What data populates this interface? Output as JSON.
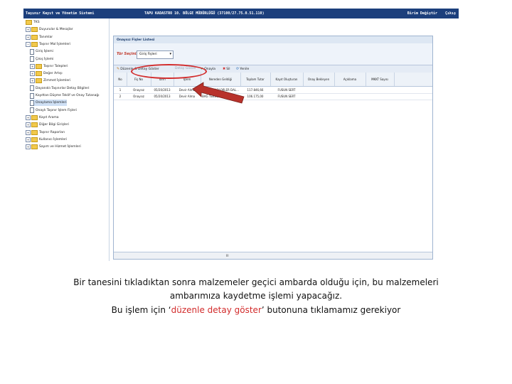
{
  "topbar": {
    "app_title": "Taşınır Kayıt ve Yönetim Sistemi",
    "office_title": "TAPU KADASTRO 10. BÖLGE MÜDÜRLÜĞÜ (37100/27.75.0.51.110)",
    "change_unit": "Birim Değiştir",
    "logout": "Çıkış"
  },
  "tree": [
    {
      "label": "TKS",
      "level": 0,
      "type": "root",
      "exp": ""
    },
    {
      "label": "Duyurular & Mesajlar",
      "level": 0,
      "type": "folder",
      "exp": "+"
    },
    {
      "label": "Tanımlar",
      "level": 0,
      "type": "folder",
      "exp": "+"
    },
    {
      "label": "Taşınır Mal İşlemleri",
      "level": 0,
      "type": "folder",
      "exp": "−"
    },
    {
      "label": "Giriş İşlemi",
      "level": 1,
      "type": "doc",
      "exp": ""
    },
    {
      "label": "Çıkış İşlemi",
      "level": 1,
      "type": "doc",
      "exp": ""
    },
    {
      "label": "Taşınır Talepleri",
      "level": 1,
      "type": "folder",
      "exp": "+"
    },
    {
      "label": "Değer Artışı",
      "level": 1,
      "type": "folder",
      "exp": "+"
    },
    {
      "label": "Zimmet İşlemleri",
      "level": 1,
      "type": "folder",
      "exp": "+"
    },
    {
      "label": "Dayanıklı Taşınırlar Detay Bilgileri",
      "level": 1,
      "type": "doc",
      "exp": ""
    },
    {
      "label": "Kayıttan Düşme Teklif ve Onay Tutanağı",
      "level": 1,
      "type": "doc",
      "exp": ""
    },
    {
      "label": "Onaylama İşlemleri",
      "level": 1,
      "type": "doc",
      "exp": "",
      "selected": true
    },
    {
      "label": "Onaylı Taşınır İşlem Fişleri",
      "level": 1,
      "type": "doc",
      "exp": ""
    },
    {
      "label": "Kayıt Arama",
      "level": 0,
      "type": "folder",
      "exp": "+"
    },
    {
      "label": "Diğer Bilgi Girişleri",
      "level": 0,
      "type": "folder",
      "exp": "+"
    },
    {
      "label": "Taşınır Raporları",
      "level": 0,
      "type": "folder",
      "exp": "+"
    },
    {
      "label": "Kullanıcı İşlemleri",
      "level": 0,
      "type": "folder",
      "exp": "+"
    },
    {
      "label": "Sayım ve Hizmet İşlemleri",
      "level": 0,
      "type": "folder",
      "exp": "+"
    }
  ],
  "panel": {
    "title": "Onaysız Fişler Listesi",
    "filter_label": "Tür Seçiniz",
    "filter_value": "Giriş Fişleri"
  },
  "toolbar": {
    "edit_detail": "Düzenle & Detay Göster",
    "show_detail": "Detay Göster",
    "approve": "Onayla",
    "delete": "Sil",
    "refresh": "Yenile"
  },
  "columns": [
    "No",
    "Fiş No",
    "Tarih",
    "İşlem",
    "Nereden Geldiği",
    "Toplam Tutar",
    "Kayıt Oluşturan",
    "Onay Bekleyen",
    "Açıklama",
    "MKKT Sayısı"
  ],
  "rows": [
    [
      "1",
      "Onaysız",
      "05/20/2013",
      "Devir Alma",
      "BAĞ TEKNOLOJİLER DAL...",
      "117.846,66",
      "FUSUN SERT",
      "",
      "",
      ""
    ],
    [
      "2",
      "Onaysız",
      "05/20/2013",
      "Devir Alma",
      "BAĞ TEKNOLOJİLER DAL...",
      "106.175,00",
      "FUSUN SERT",
      "",
      "",
      ""
    ]
  ],
  "scroll_glyph": "III",
  "caption": {
    "line1": "Bir tanesini tıkladıktan sonra malzemeler geçici ambarda olduğu için, bu malzemeleri",
    "line2": "ambarımıza kaydetme işlemi yapacağız.",
    "line3_pre": "Bu işlem için ‘",
    "line3_red": "düzenle detay göster",
    "line3_post": "’ butonuna tıklamamız gerekiyor"
  }
}
